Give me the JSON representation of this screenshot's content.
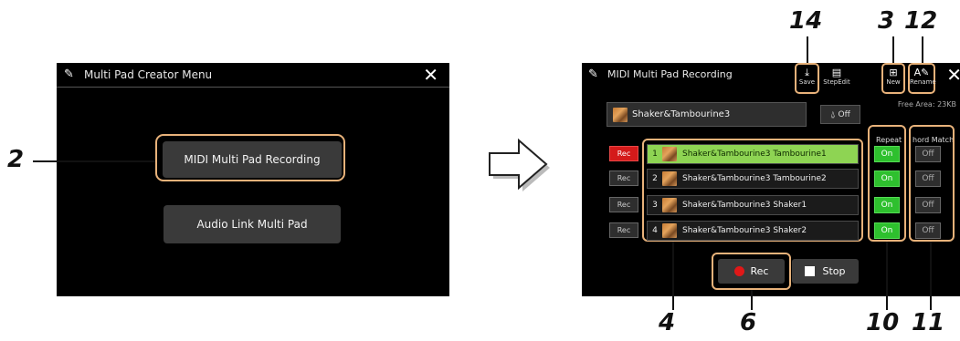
{
  "left_panel": {
    "title": "Multi Pad Creator Menu",
    "icon": "multipad-edit-icon",
    "close": "✕",
    "buttons": {
      "midi": "MIDI Multi Pad Recording",
      "audio": "Audio Link Multi Pad"
    }
  },
  "right_panel": {
    "title": "MIDI Multi Pad Recording",
    "icon": "multipad-edit-icon",
    "close": "✕",
    "toolbar": {
      "save": "Save",
      "stepedit": "StepEdit",
      "new": "New",
      "rename": "Rename"
    },
    "free_area": "Free Area:  23KB",
    "bank_name": "Shaker&Tambourine3",
    "metronome": "Off",
    "headers": {
      "repeat": "Repeat",
      "chord_match": "hord Match"
    },
    "pads": [
      {
        "num": "1",
        "name": "Shaker&Tambourine3 Tambourine1",
        "rec": "Rec",
        "repeat": "On",
        "chord": "Off"
      },
      {
        "num": "2",
        "name": "Shaker&Tambourine3 Tambourine2",
        "rec": "Rec",
        "repeat": "On",
        "chord": "Off"
      },
      {
        "num": "3",
        "name": "Shaker&Tambourine3 Shaker1",
        "rec": "Rec",
        "repeat": "On",
        "chord": "Off"
      },
      {
        "num": "4",
        "name": "Shaker&Tambourine3 Shaker2",
        "rec": "Rec",
        "repeat": "On",
        "chord": "Off"
      }
    ],
    "rec_button": "Rec",
    "stop_button": "Stop"
  },
  "callouts": {
    "c2": "2",
    "c14": "14",
    "c3": "3",
    "c12": "12",
    "c4": "4",
    "c6": "6",
    "c10": "10",
    "c11": "11"
  },
  "colors": {
    "screen_bg": "#000000",
    "highlight_outline": "#e8b27a",
    "selected_pad": "#8ed453",
    "on_toggle": "#2ec02e",
    "rec_active": "#d41a1a"
  }
}
